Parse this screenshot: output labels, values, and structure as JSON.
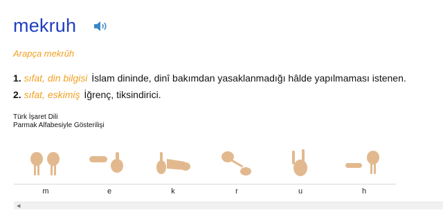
{
  "entry": {
    "word": "mekruh",
    "audio_icon": "speaker-icon",
    "origin": "Arapça mekrûh"
  },
  "definitions": [
    {
      "number": "1.",
      "tag": "sıfat, din bilgisi",
      "text": "İslam dininde, dinî bakımdan yasaklanmadığı hâlde yapılmaması istenen."
    },
    {
      "number": "2.",
      "tag": "sıfat, eskimiş",
      "text": "İğrenç, tiksindirici."
    }
  ],
  "sign_language": {
    "title": "Türk İşaret Dili",
    "subtitle": "Parmak Alfabesiyle Gösterilişi",
    "letters": [
      "m",
      "e",
      "k",
      "r",
      "u",
      "h"
    ]
  },
  "colors": {
    "word": "#1f3fbf",
    "accent": "#f0a020",
    "speaker": "#3a86c8",
    "skin": "#e2b98e"
  }
}
